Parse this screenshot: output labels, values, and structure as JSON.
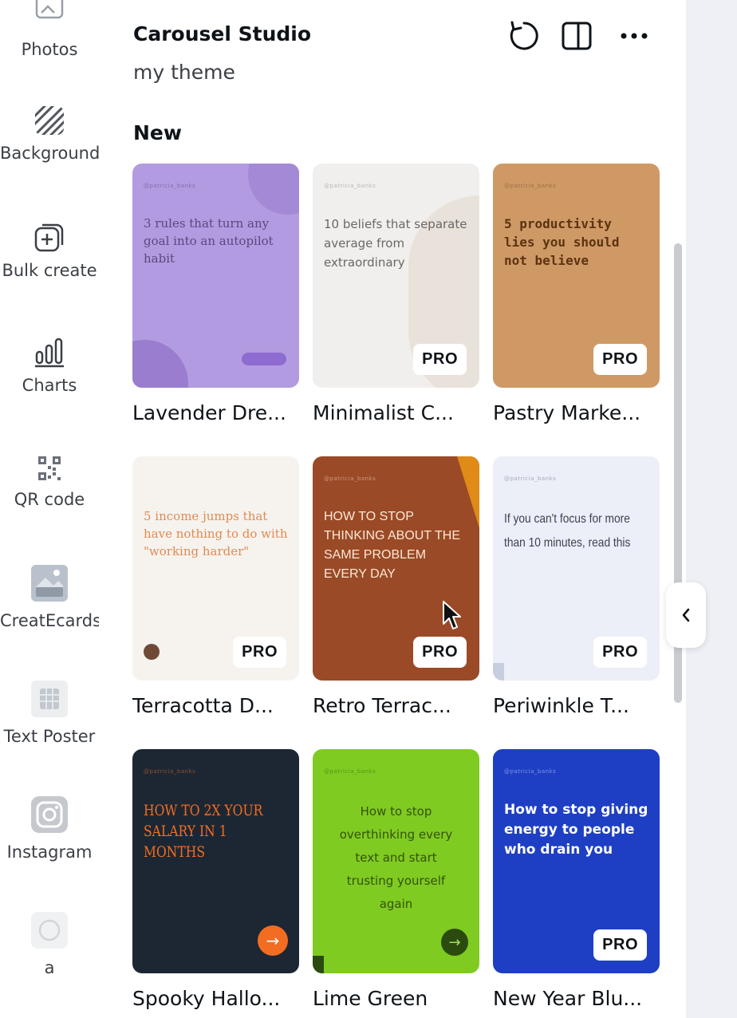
{
  "rail": [
    {
      "label": "Photos",
      "icon": "photos-icon"
    },
    {
      "label": "Background",
      "icon": "background-icon"
    },
    {
      "label": "Bulk create",
      "icon": "bulk-create-icon"
    },
    {
      "label": "Charts",
      "icon": "charts-icon"
    },
    {
      "label": "QR code",
      "icon": "qr-code-icon"
    },
    {
      "label": "CreatEcards",
      "icon": "createcards-icon"
    },
    {
      "label": "Text Poster",
      "icon": "text-poster-icon"
    },
    {
      "label": "Instagram",
      "icon": "instagram-icon"
    },
    {
      "label": "a",
      "icon": "app-a-icon"
    }
  ],
  "header": {
    "title": "Carousel Studio",
    "subtitle": "my theme",
    "icons": [
      "refresh-icon",
      "split-view-icon",
      "more-icon"
    ]
  },
  "section_title": "New",
  "pro_label": "PRO",
  "templates": [
    {
      "title": "Lavender Dre...",
      "text": "3 rules that turn any goal into an autopilot habit",
      "bg": "#b29be0",
      "fg": "#5a4782",
      "pro": false
    },
    {
      "title": "Minimalist C...",
      "text": "10 beliefs that separate average from extraordinary",
      "bg": "#f1efed",
      "fg": "#6b6765",
      "pro": true
    },
    {
      "title": "Pastry Marke...",
      "text": "5 productivity lies you should not believe",
      "bg": "#cf9966",
      "fg": "#5b3310",
      "pro": true
    },
    {
      "title": "Terracotta D...",
      "text": "5 income jumps that have nothing to do with \"working harder\"",
      "bg": "#f6f3ef",
      "fg": "#e08a50",
      "pro": true
    },
    {
      "title": "Retro Terrac...",
      "text": "HOW TO STOP THINKING ABOUT THE SAME PROBLEM EVERY DAY",
      "bg": "#9a4a26",
      "fg": "#fbe8d6",
      "pro": true
    },
    {
      "title": "Periwinkle T...",
      "text": "If you can't focus for more than 10 minutes, read this",
      "bg": "#eceff7",
      "fg": "#3e4151",
      "pro": true
    },
    {
      "title": "Spooky Hallo...",
      "text": "HOW TO 2X YOUR SALARY IN 1 MONTHS",
      "bg": "#1d2734",
      "fg": "#f26d21",
      "pro": false
    },
    {
      "title": "Lime Green",
      "text": "How to stop overthinking every text and start trusting yourself again",
      "bg": "#7fcb22",
      "fg": "#34520c",
      "pro": false
    },
    {
      "title": "New Year Blu...",
      "text": "How to stop giving energy to people who drain you",
      "bg": "#1e3fc4",
      "fg": "#ffffff",
      "pro": true
    }
  ]
}
